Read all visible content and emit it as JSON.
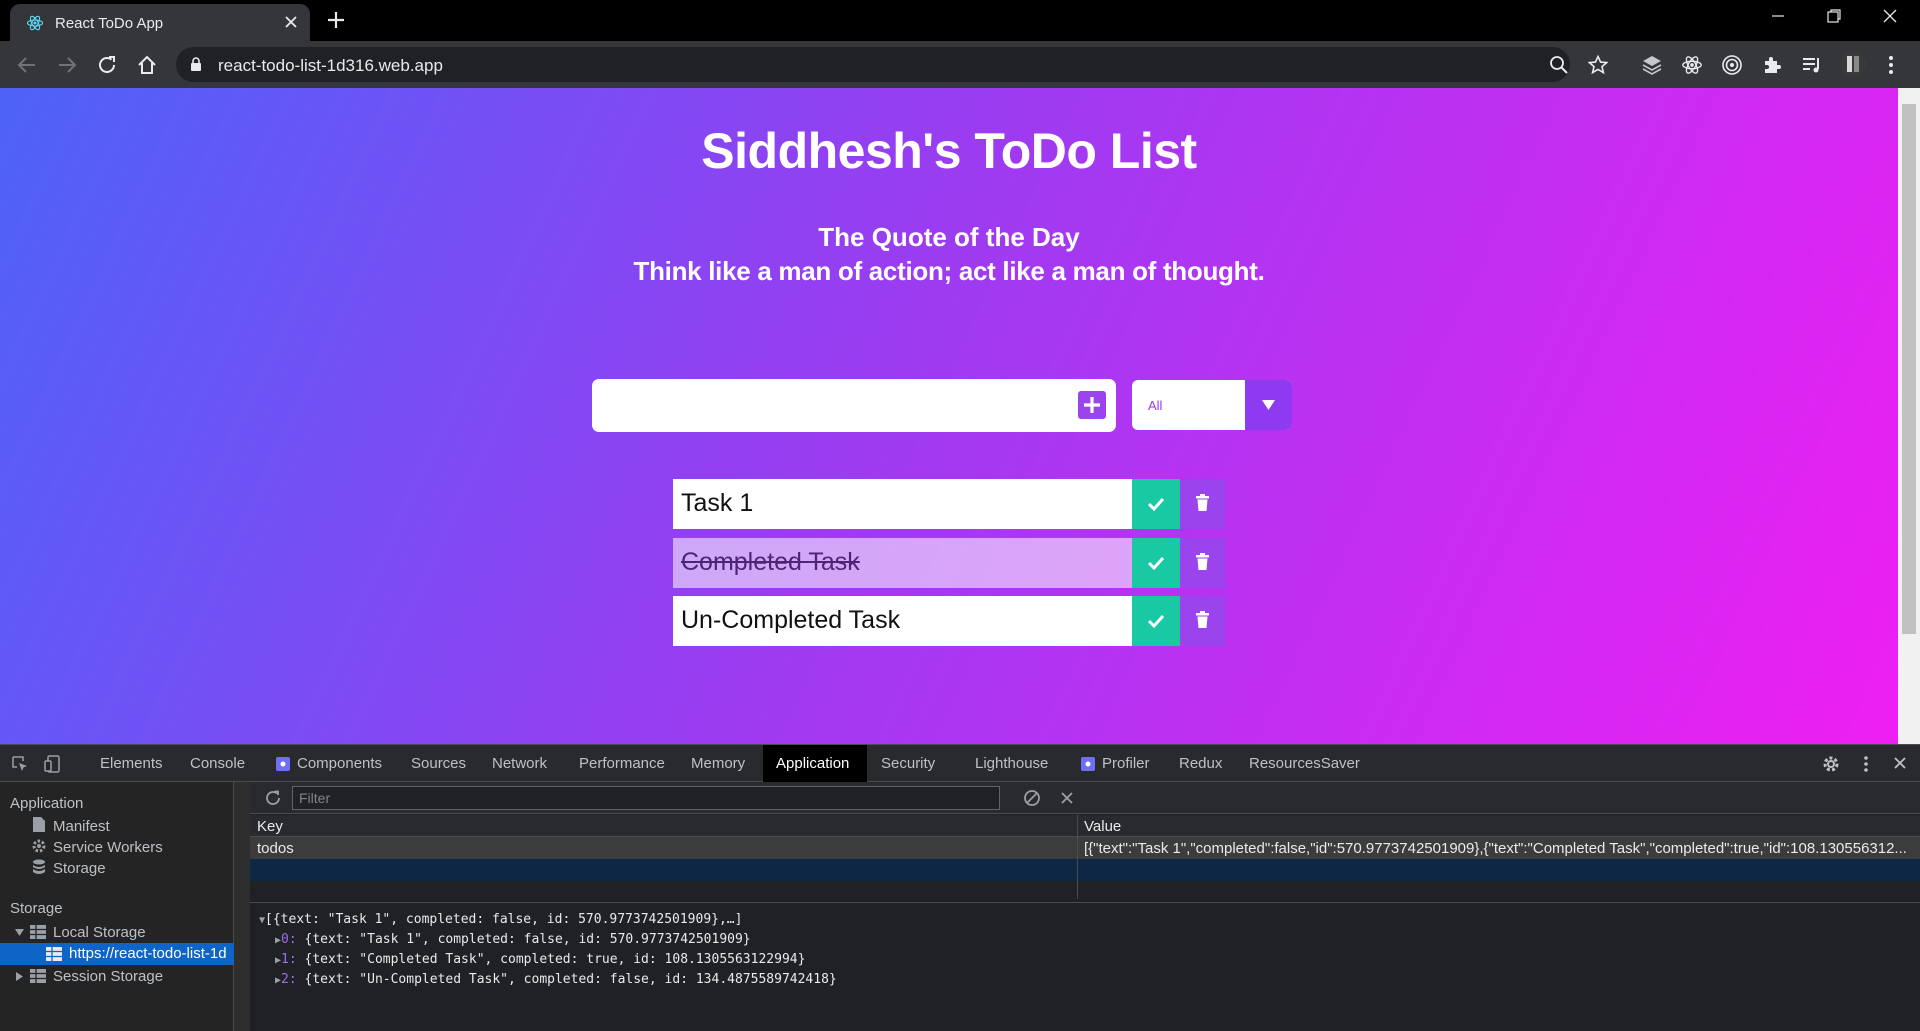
{
  "browser": {
    "tab_title": "React ToDo App",
    "url": "react-todo-list-1d316.web.app",
    "icons": [
      "react-icon",
      "close-icon",
      "plus-icon",
      "minimize-icon",
      "restore-icon",
      "close-window-icon",
      "back-icon",
      "forward-icon",
      "reload-icon",
      "home-icon",
      "lock-icon",
      "zoom-icon",
      "star-icon",
      "layers-icon",
      "react-devtools-icon",
      "target-icon",
      "extensions-icon",
      "media-icon",
      "profile-avatar-icon",
      "menu-icon"
    ]
  },
  "app": {
    "title": "Siddhesh's ToDo List",
    "quote_heading": "The Quote of the Day",
    "quote_text": "Think like a man of action; act like a man of thought.",
    "input_value": "",
    "filter_selected": "All",
    "todos": [
      {
        "text": "Task 1",
        "completed": false
      },
      {
        "text": "Completed Task",
        "completed": true
      },
      {
        "text": "Un-Completed Task",
        "completed": false
      }
    ],
    "colors": {
      "accent": "#8d3af0",
      "check": "#19c9a4",
      "gradient_start": "#4d63f8",
      "gradient_end": "#f01ef2"
    }
  },
  "devtools": {
    "tabs": [
      "Elements",
      "Console",
      "Components",
      "Sources",
      "Network",
      "Performance",
      "Memory",
      "Application",
      "Security",
      "Lighthouse",
      "Profiler",
      "Redux",
      "ResourcesSaver"
    ],
    "active_tab": "Application",
    "sidebar": {
      "application_heading": "Application",
      "application_items": [
        "Manifest",
        "Service Workers",
        "Storage"
      ],
      "storage_heading": "Storage",
      "local_storage": "Local Storage",
      "local_storage_origin": "https://react-todo-list-1d",
      "session_storage": "Session Storage"
    },
    "filter_placeholder": "Filter",
    "columns": {
      "key": "Key",
      "value": "Value"
    },
    "row": {
      "key": "todos",
      "value": "[{\"text\":\"Task 1\",\"completed\":false,\"id\":570.9773742501909},{\"text\":\"Completed Task\",\"completed\":true,\"id\":108.130556312..."
    },
    "preview": {
      "summary": "[{text: \"Task 1\", completed: false, id: 570.9773742501909},…]",
      "items": [
        {
          "index": "0:",
          "text": "{text: \"Task 1\", completed: false, id: 570.9773742501909}"
        },
        {
          "index": "1:",
          "text": "{text: \"Completed Task\", completed: true, id: 108.1305563122994}"
        },
        {
          "index": "2:",
          "text": "{text: \"Un-Completed Task\", completed: false, id: 134.4875589742418}"
        }
      ]
    }
  }
}
